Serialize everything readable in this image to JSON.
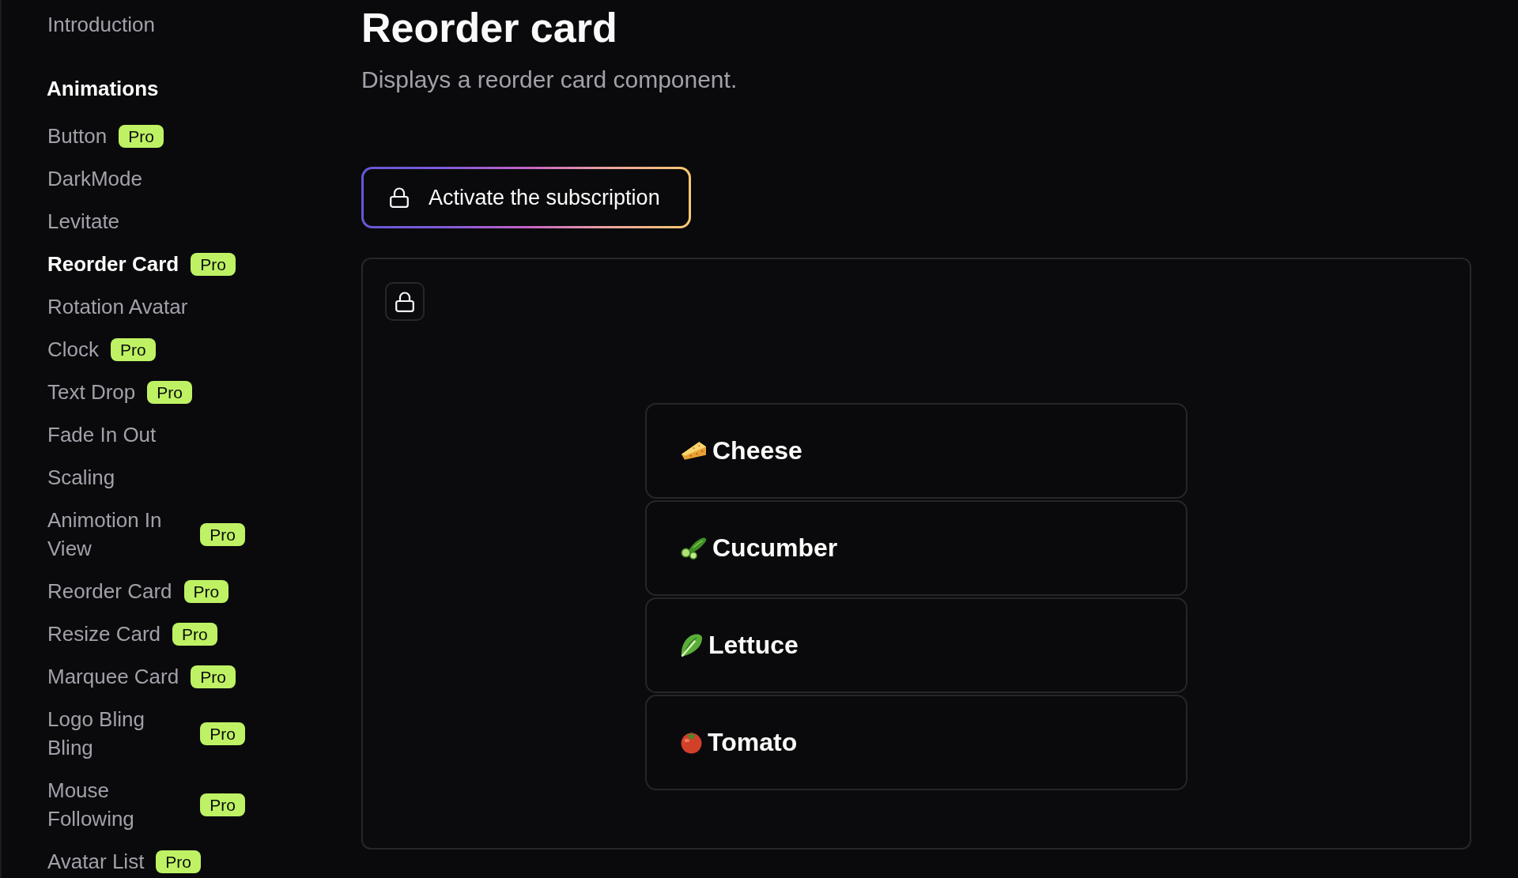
{
  "sidebar": {
    "links": [
      {
        "label": "Introduction",
        "selected": false
      }
    ],
    "sections": [
      {
        "title": "Animations",
        "items": [
          {
            "label": "Button",
            "badge": "Pro",
            "selected": false
          },
          {
            "label": "DarkMode",
            "selected": false
          },
          {
            "label": "Levitate",
            "selected": false
          },
          {
            "label": "Reorder Card",
            "badge": "Pro",
            "selected": true
          },
          {
            "label": "Rotation Avatar",
            "selected": false
          },
          {
            "label": "Clock",
            "badge": "Pro",
            "selected": false
          },
          {
            "label": "Text Drop",
            "badge": "Pro",
            "selected": false
          },
          {
            "label": "Fade In Out",
            "selected": false
          },
          {
            "label": "Scaling",
            "selected": false
          },
          {
            "label": "Animotion In View",
            "badge": "Pro",
            "selected": false
          },
          {
            "label": "Reorder Card",
            "badge": "Pro",
            "selected": false
          },
          {
            "label": "Resize Card",
            "badge": "Pro",
            "selected": false
          },
          {
            "label": "Marquee Card",
            "badge": "Pro",
            "selected": false
          },
          {
            "label": "Logo Bling Bling",
            "badge": "Pro",
            "selected": false
          },
          {
            "label": "Mouse Following",
            "badge": "Pro",
            "selected": false
          },
          {
            "label": "Avatar List",
            "badge": "Pro",
            "selected": false
          }
        ]
      }
    ]
  },
  "header": {
    "title": "Reorder card",
    "description": "Displays a reorder card component."
  },
  "subscribe_button": {
    "label": "Activate the subscription"
  },
  "preview": {
    "cards": [
      {
        "kind": "cheese",
        "label": "Cheese"
      },
      {
        "kind": "cucumber",
        "label": "Cucumber"
      },
      {
        "kind": "lettuce",
        "label": "Lettuce"
      },
      {
        "kind": "tomato",
        "label": "Tomato"
      }
    ]
  }
}
